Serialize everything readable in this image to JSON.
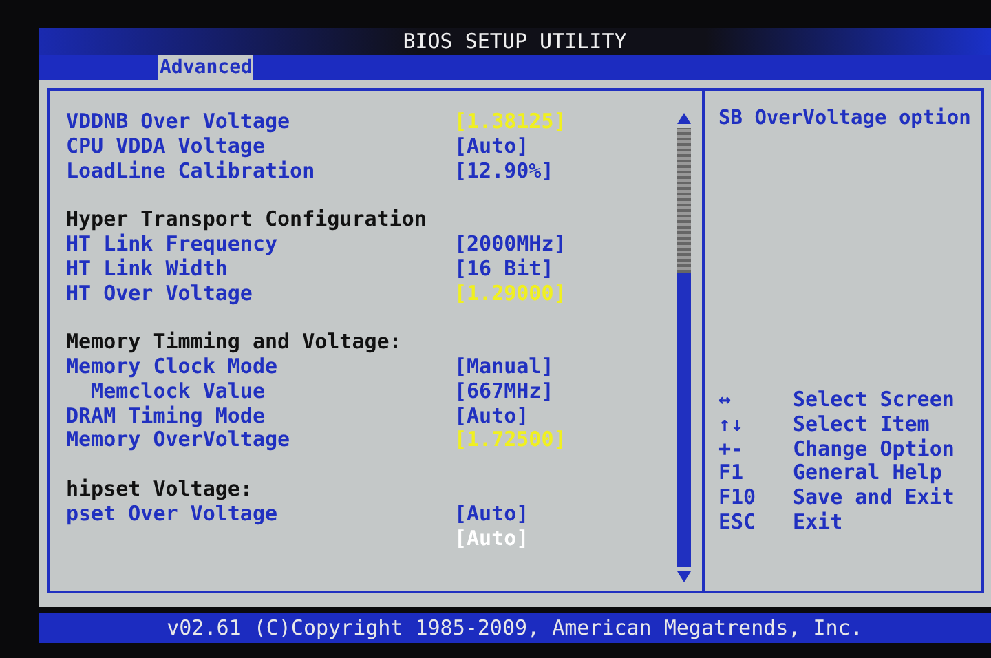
{
  "title": "BIOS SETUP UTILITY",
  "tabs": [
    {
      "label": "Advanced",
      "selected": true
    }
  ],
  "sections": [
    {
      "items": [
        {
          "label": "VDDNB Over Voltage",
          "value": "[1.38125]",
          "kind": "typed",
          "selected": false
        },
        {
          "label": "CPU VDDA Voltage",
          "value": "[Auto]",
          "kind": "option",
          "selected": false
        },
        {
          "label": "LoadLine Calibration",
          "value": "[12.90%]",
          "kind": "option",
          "selected": false
        }
      ]
    },
    {
      "heading": "Hyper Transport Configuration",
      "items": [
        {
          "label": "HT Link Frequency",
          "value": "[2000MHz]",
          "kind": "option",
          "selected": false
        },
        {
          "label": "HT Link Width",
          "value": "[16 Bit]",
          "kind": "option",
          "selected": false
        },
        {
          "label": "HT Over Voltage",
          "value": "[1.29000]",
          "kind": "typed",
          "selected": false
        }
      ]
    },
    {
      "heading": "Memory Timming and Voltage:",
      "items": [
        {
          "label": "Memory Clock Mode",
          "value": "[Manual]",
          "kind": "option",
          "selected": false,
          "children": [
            {
              "label": "Memclock Value",
              "value": "[667MHz]",
              "kind": "option",
              "selected": false
            }
          ]
        },
        {
          "label": "DRAM Timing Mode",
          "value": "[Auto]",
          "kind": "option",
          "selected": false
        },
        {
          "label": "Memory OverVoltage",
          "value": "[1.72500]",
          "kind": "typed",
          "selected": false
        }
      ]
    },
    {
      "heading": "hipset Voltage:",
      "items": [
        {
          "label": "pset Over Voltage",
          "value": "[Auto]",
          "kind": "option",
          "selected": false
        },
        {
          "value": "[Auto]",
          "kind": "option",
          "selected": true
        }
      ]
    }
  ],
  "help": "SB OverVoltage option",
  "keys": [
    {
      "key": "↔",
      "action": "Select Screen"
    },
    {
      "key": "↑↓",
      "action": "Select Item"
    },
    {
      "key": "+-",
      "action": "Change Option"
    },
    {
      "key": "F1",
      "action": "General Help"
    },
    {
      "key": "F10",
      "action": "Save and Exit"
    },
    {
      "key": "ESC",
      "action": "Exit"
    }
  ],
  "footer": "v02.61 (C)Copyright 1985-2009, American Megatrends, Inc."
}
